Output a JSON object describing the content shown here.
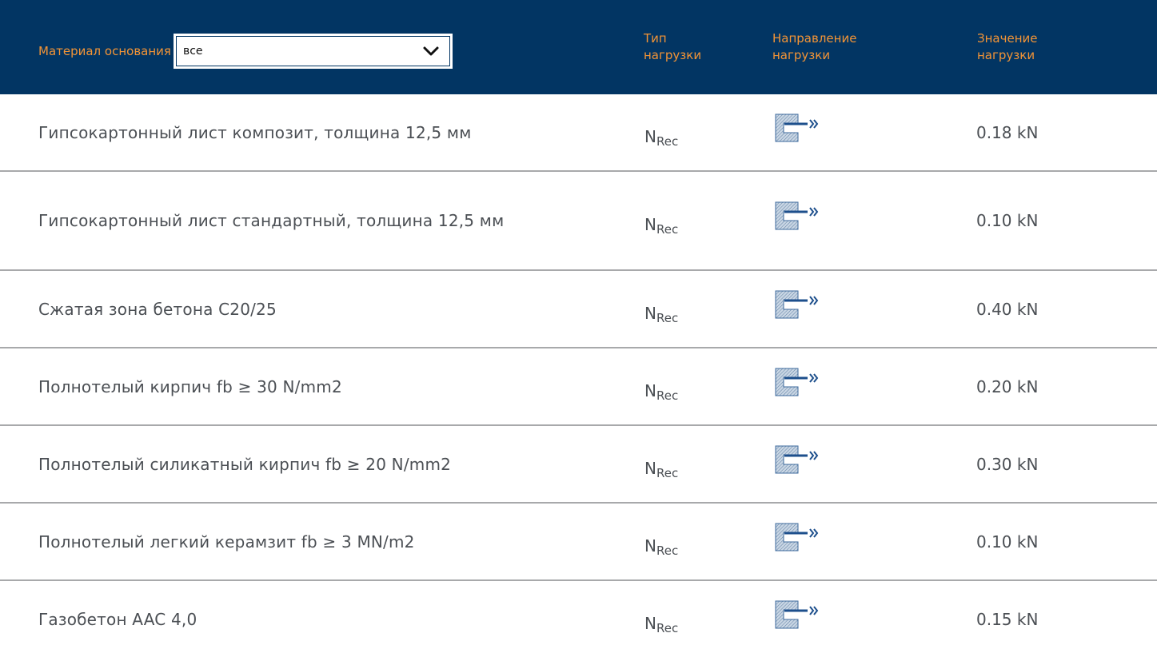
{
  "header": {
    "filter_label": "Материал основания",
    "filter_value": "все",
    "col_type": "Тип нагрузки",
    "col_direction": "Направление нагрузки",
    "col_value": "Значение нагрузки"
  },
  "icons": {
    "select_arrow": "chevron-down-icon",
    "direction": "tension-load-direction-icon"
  },
  "colors": {
    "header_bg": "#023563",
    "header_text": "#f39436",
    "body_text": "#4b4f54",
    "divider": "#a8a9ab"
  },
  "rows": [
    {
      "material": "Гипсокартонный лист композит, толщина 12,5 мм",
      "type_main": "N",
      "type_sub": "Rec",
      "value": "0.18 kN"
    },
    {
      "material": "Гипсокартонный лист стандартный, толщина 12,5 мм",
      "type_main": "N",
      "type_sub": "Rec",
      "value": "0.10 kN"
    },
    {
      "material": "Сжатая зона бетона C20/25",
      "type_main": "N",
      "type_sub": "Rec",
      "value": "0.40 kN"
    },
    {
      "material": "Полнотелый кирпич fb ≥ 30 N/mm2",
      "type_main": "N",
      "type_sub": "Rec",
      "value": "0.20 kN"
    },
    {
      "material": "Полнотелый силикатный кирпич fb ≥ 20 N/mm2",
      "type_main": "N",
      "type_sub": "Rec",
      "value": "0.30 kN"
    },
    {
      "material": "Полнотелый легкий керамзит fb ≥ 3 MN/m2",
      "type_main": "N",
      "type_sub": "Rec",
      "value": "0.10 kN"
    },
    {
      "material": "Газобетон AAC 4,0",
      "type_main": "N",
      "type_sub": "Rec",
      "value": "0.15 kN"
    }
  ]
}
